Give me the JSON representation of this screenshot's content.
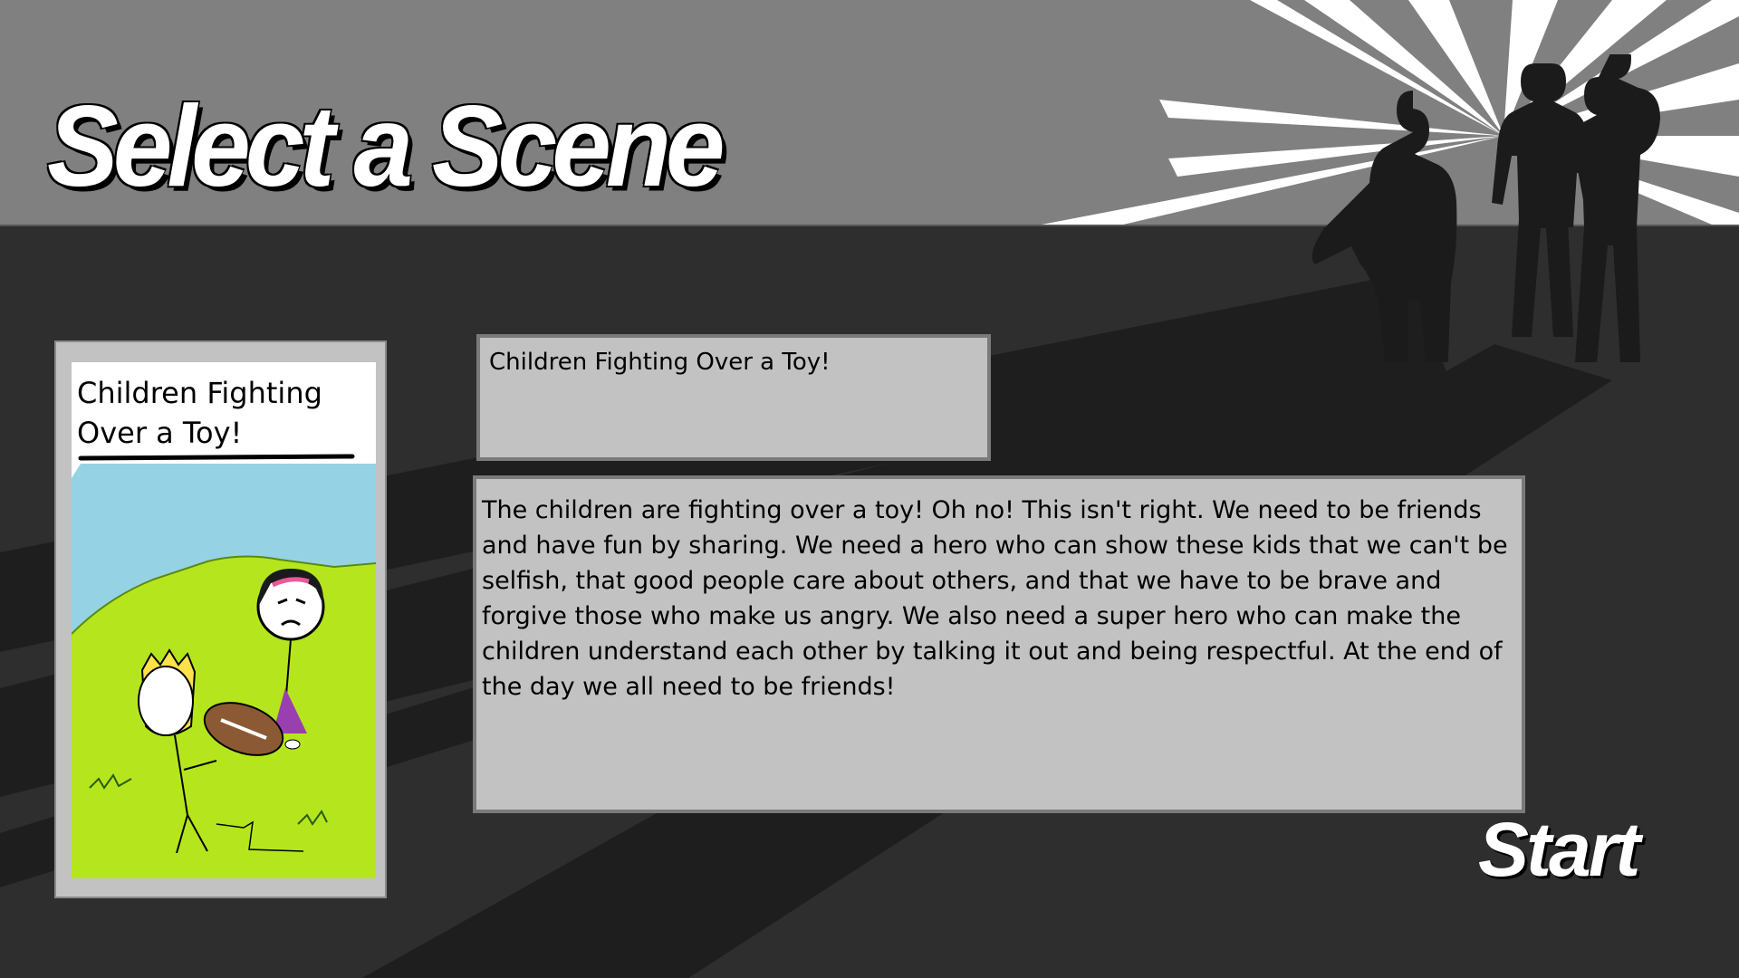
{
  "screen": {
    "title": "Select a Scene",
    "start_label": "Start"
  },
  "scene": {
    "card_title": "Children Fighting Over a Toy!",
    "name": "Children Fighting Over a Toy!",
    "description": "The children are fighting over a toy! Oh no! This isn't right. We need to be friends and have fun by sharing. We need a hero who can show these kids that we can't be selfish, that good people care about others, and that we have to be brave and forgive those who make us angry. We also need a super hero who can make the children understand each other by talking it out and being respectful. At the end of the day we all need to be friends!"
  },
  "colors": {
    "top_band": "#808080",
    "bottom_area": "#2e2e2e",
    "panel": "#c2c2c2",
    "panel_border": "#7a7a7a",
    "sky": "#95d3e4",
    "grass": "#b5e61d"
  },
  "icons": {
    "hero_silhouettes": "superheroes-silhouette-icon",
    "card_drawing": "children-with-football-drawing"
  }
}
